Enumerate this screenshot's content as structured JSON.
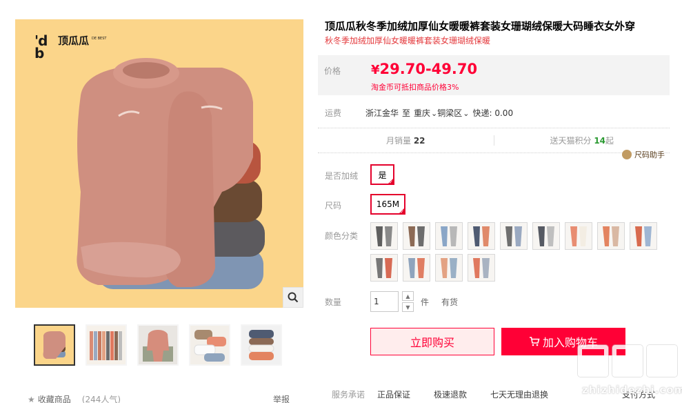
{
  "brand": {
    "mark": "'d b",
    "name": "顶瓜瓜",
    "tagline": "DE BEST"
  },
  "gallery": {
    "thumbs": [
      "main",
      "colors",
      "pink-set",
      "folded",
      "stack"
    ],
    "active_thumb": 0
  },
  "footer_left": {
    "collect_label": "收藏商品",
    "collect_count": "(244人气)",
    "report_label": "举报"
  },
  "product": {
    "title": "顶瓜瓜秋冬季加绒加厚仙女暖暖裤套装女珊瑚绒保暖大码睡衣女外穿",
    "subtitle": "秋冬季加绒加厚仙女暖暖裤套装女珊瑚绒保暖"
  },
  "price": {
    "label": "价格",
    "currency": "¥",
    "range": "29.70-49.70",
    "note": "淘金币可抵扣商品价格3%"
  },
  "shipping": {
    "label": "运费",
    "from": "浙江金华",
    "to_word": "至",
    "city": "重庆",
    "district": "铜梁区",
    "fee": "快递: 0.00"
  },
  "stats": {
    "monthly_sales_label": "月销量",
    "monthly_sales": "22",
    "points_label": "送天猫积分",
    "points_value": "14",
    "points_suffix": "起"
  },
  "size_helper": {
    "label": "尺码助手"
  },
  "options": {
    "fleece_label": "是否加绒",
    "fleece_value": "是",
    "size_label": "尺码",
    "size_value": "165M",
    "color_label": "颜色分类"
  },
  "swatch_colors": [
    [
      "#5f5f5f",
      "#8a8a8a"
    ],
    [
      "#8c6a55",
      "#6d6d6d"
    ],
    [
      "#8aa6c7",
      "#b8b8b8"
    ],
    [
      "#4f5b72",
      "#e08a6a"
    ],
    [
      "#6f6f6f",
      "#9aa9c1"
    ],
    [
      "#565a63",
      "#bfbfbf"
    ],
    [
      "#e88d72",
      "#f3ede3"
    ],
    [
      "#e38460",
      "#d9b8a3"
    ],
    [
      "#d86b4f",
      "#9fb6d3"
    ],
    [
      "#777777",
      "#d76a54"
    ],
    [
      "#8fa4bd",
      "#e07e63"
    ],
    [
      "#e3a283",
      "#9ab0c6"
    ],
    [
      "#e0795f",
      "#a9b3c2"
    ]
  ],
  "quantity": {
    "label": "数量",
    "value": "1",
    "unit": "件",
    "stock": "有货"
  },
  "actions": {
    "buy_now": "立即购买",
    "add_to_cart": "加入购物车"
  },
  "promise": {
    "label": "服务承诺",
    "items": [
      "正品保证",
      "极速退款",
      "七天无理由退换"
    ],
    "payment": "支付方式"
  },
  "watermark": {
    "text": "zhizhidezhi.com"
  },
  "colors": {
    "accent": "#ff0036",
    "subtitle_red": "#e4393c",
    "main_bg": "#fbd58a",
    "points_green": "#2b9a32"
  }
}
